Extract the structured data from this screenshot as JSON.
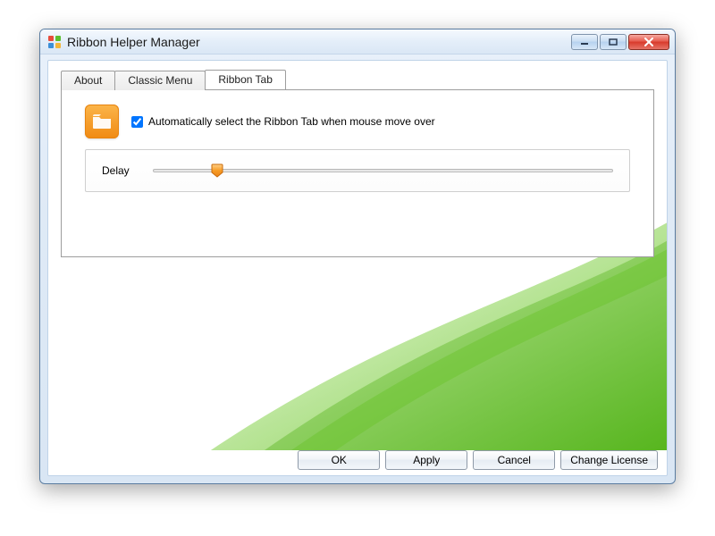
{
  "window": {
    "title": "Ribbon Helper Manager"
  },
  "tabs": [
    {
      "label": "About",
      "active": false
    },
    {
      "label": "Classic Menu",
      "active": false
    },
    {
      "label": "Ribbon Tab",
      "active": true
    }
  ],
  "ribbon_tab": {
    "auto_select_checkbox_label": "Automatically select the Ribbon Tab when mouse move over",
    "auto_select_checked": true,
    "delay_label": "Delay",
    "delay_value_percent": 14
  },
  "footer": {
    "ok": "OK",
    "apply": "Apply",
    "cancel": "Cancel",
    "change_license": "Change License"
  },
  "colors": {
    "accent_orange": "#f08a13",
    "green_swoosh_dark": "#3fa40f",
    "green_swoosh_light": "#9fe06a"
  }
}
